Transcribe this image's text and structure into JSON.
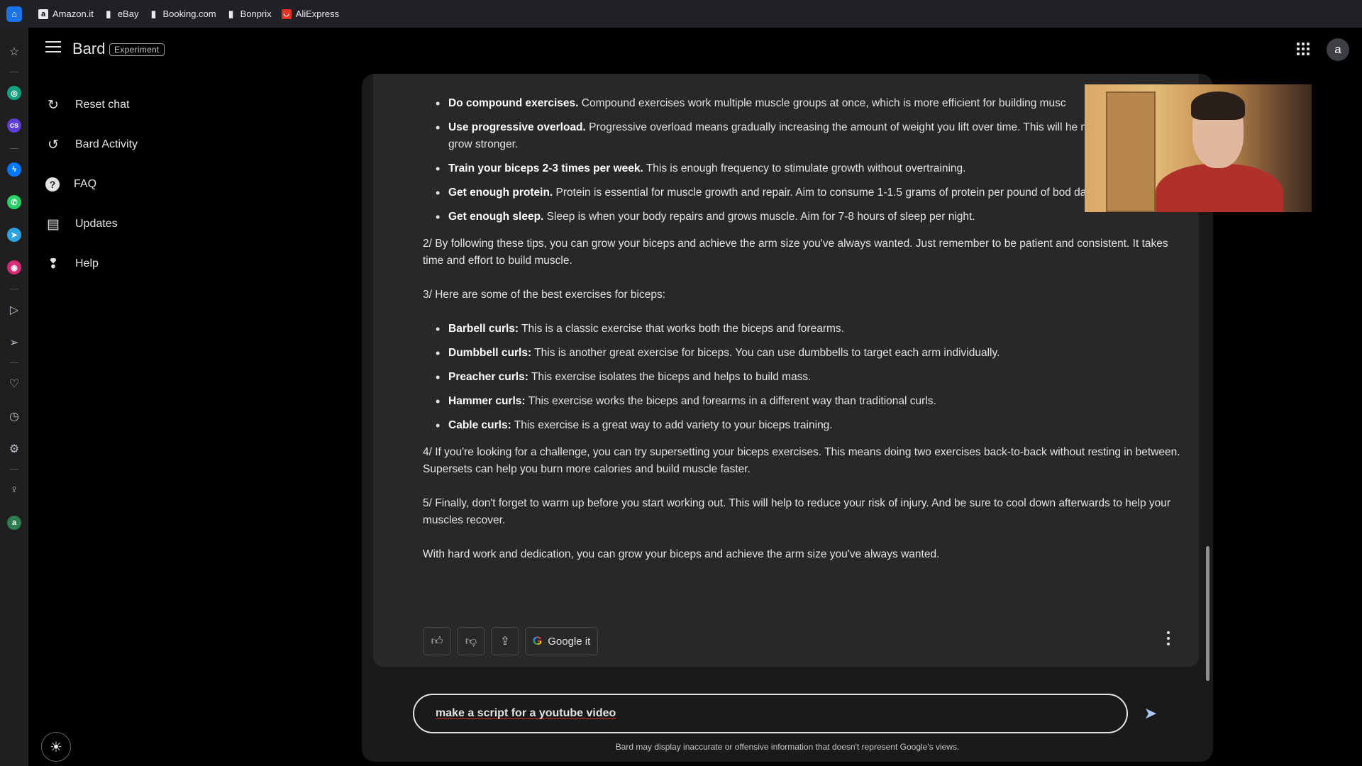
{
  "bookmarks": [
    {
      "label": "Amazon.it",
      "icon": "amazon-icon"
    },
    {
      "label": "eBay",
      "icon": "page-icon"
    },
    {
      "label": "Booking.com",
      "icon": "page-icon"
    },
    {
      "label": "Bonprix",
      "icon": "page-icon"
    },
    {
      "label": "AliExpress",
      "icon": "aliexpress-icon"
    }
  ],
  "header": {
    "brand": "Bard",
    "badge": "Experiment",
    "avatar_letter": "a"
  },
  "nav": [
    {
      "label": "Reset chat",
      "icon": "reset-icon"
    },
    {
      "label": "Bard Activity",
      "icon": "history-icon"
    },
    {
      "label": "FAQ",
      "icon": "help-circle-icon"
    },
    {
      "label": "Updates",
      "icon": "calendar-icon"
    },
    {
      "label": "Help",
      "icon": "feedback-icon"
    }
  ],
  "response": {
    "bullets_top": [
      {
        "bold": "Do compound exercises.",
        "text": " Compound exercises work multiple muscle groups at once, which is more efficient for building musc"
      },
      {
        "bold": "Use progressive overload.",
        "text": " Progressive overload means gradually increasing the amount of weight you lift over time. This will he muscles adapt and grow stronger."
      },
      {
        "bold": "Train your biceps 2-3 times per week.",
        "text": " This is enough frequency to stimulate growth without overtraining."
      },
      {
        "bold": "Get enough protein.",
        "text": " Protein is essential for muscle growth and repair. Aim to consume 1-1.5 grams of protein per pound of bod day."
      },
      {
        "bold": "Get enough sleep.",
        "text": " Sleep is when your body repairs and grows muscle. Aim for 7-8 hours of sleep per night."
      }
    ],
    "p2": "2/ By following these tips, you can grow your biceps and achieve the arm size you've always wanted. Just remember to be patient and consistent. It takes time and effort to build muscle.",
    "p3": "3/ Here are some of the best exercises for biceps:",
    "bullets_exercises": [
      {
        "bold": "Barbell curls:",
        "text": " This is a classic exercise that works both the biceps and forearms."
      },
      {
        "bold": "Dumbbell curls:",
        "text": " This is another great exercise for biceps. You can use dumbbells to target each arm individually."
      },
      {
        "bold": "Preacher curls:",
        "text": " This exercise isolates the biceps and helps to build mass."
      },
      {
        "bold": "Hammer curls:",
        "text": " This exercise works the biceps and forearms in a different way than traditional curls."
      },
      {
        "bold": "Cable curls:",
        "text": " This exercise is a great way to add variety to your biceps training."
      }
    ],
    "p4": "4/ If you're looking for a challenge, you can try supersetting your biceps exercises. This means doing two exercises back-to-back without resting in between. Supersets can help you burn more calories and build muscle faster.",
    "p5": "5/ Finally, don't forget to warm up before you start working out. This will help to reduce your risk of injury. And be sure to cool down afterwards to help your muscles recover.",
    "p6": "With hard work and dedication, you can grow your biceps and achieve the arm size you've always wanted."
  },
  "actions": {
    "google_it": "Google it"
  },
  "prompt": {
    "value": "make a script for a youtube video"
  },
  "disclaimer": "Bard may display inaccurate or offensive information that doesn't represent Google's views."
}
